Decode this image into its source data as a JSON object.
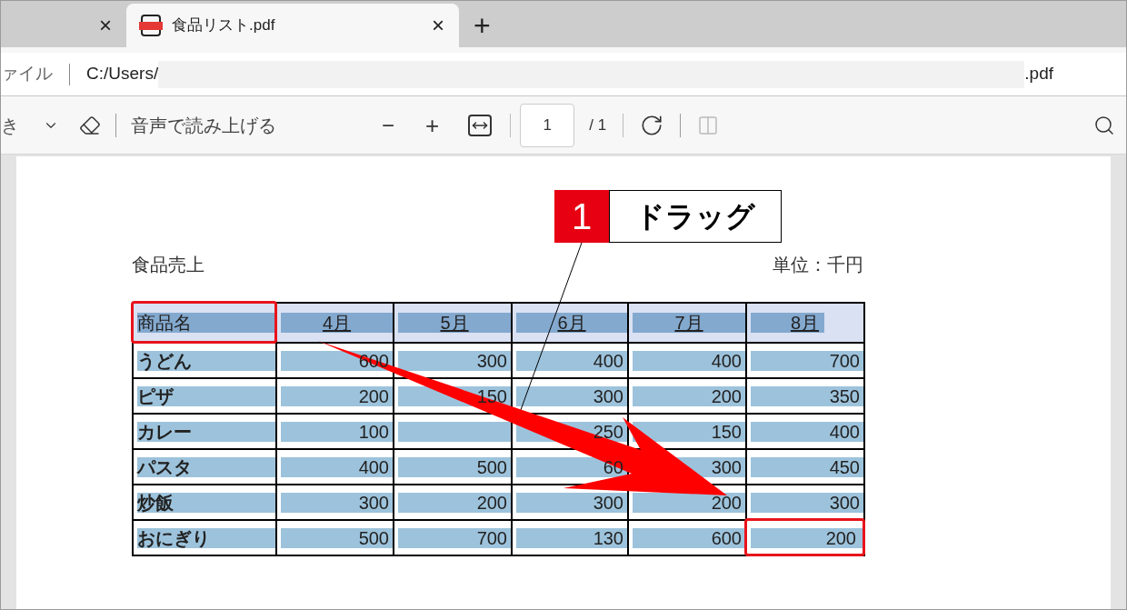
{
  "tabs": [
    {
      "selected": false,
      "close": "×"
    },
    {
      "selected": true,
      "title": "食品リスト.pdf",
      "close": "×"
    }
  ],
  "new_tab": "+",
  "address_bar": {
    "label": "ァイル",
    "path_start": "C:/Users/",
    "path_end": ".pdf"
  },
  "toolbar": {
    "cut_label": "き",
    "read_aloud": "音声で読み上げる",
    "zoom_out": "−",
    "zoom_in": "+",
    "page_field": "1",
    "page_total": "/ 1",
    "two_page_disabled": true
  },
  "document": {
    "title": "食品売上",
    "unit": "単位：千円",
    "text_selected": true,
    "table": {
      "columns": [
        {
          "text": "商品名",
          "outlined": true
        },
        {
          "text": "4月",
          "outlined": false
        },
        {
          "text": "5月",
          "outlined": false
        },
        {
          "text": "6月",
          "outlined": false
        },
        {
          "text": "7月",
          "outlined": false
        },
        {
          "text": "8月",
          "outlined": false
        }
      ],
      "rows": [
        {
          "cells": [
            {
              "text": "うどん",
              "outlined": false
            },
            {
              "text": "600",
              "outlined": false
            },
            {
              "text": "300",
              "outlined": false
            },
            {
              "text": "400",
              "outlined": false
            },
            {
              "text": "400",
              "outlined": false
            },
            {
              "text": "700",
              "outlined": false
            }
          ]
        },
        {
          "cells": [
            {
              "text": "ピザ",
              "outlined": false
            },
            {
              "text": "200",
              "outlined": false
            },
            {
              "text": "150",
              "outlined": false
            },
            {
              "text": "300",
              "outlined": false
            },
            {
              "text": "200",
              "outlined": false
            },
            {
              "text": "350",
              "outlined": false
            }
          ]
        },
        {
          "cells": [
            {
              "text": "カレー",
              "outlined": false
            },
            {
              "text": "100",
              "outlined": false
            },
            {
              "outlined": false
            },
            {
              "text": "250",
              "outlined": false
            },
            {
              "text": "150",
              "outlined": false
            },
            {
              "text": "400",
              "outlined": false
            }
          ]
        },
        {
          "cells": [
            {
              "text": "パスタ",
              "outlined": false
            },
            {
              "text": "400",
              "outlined": false
            },
            {
              "text": "500",
              "outlined": false
            },
            {
              "text": "60",
              "outlined": false
            },
            {
              "text": "300",
              "outlined": false
            },
            {
              "text": "450",
              "outlined": false
            }
          ]
        },
        {
          "cells": [
            {
              "text": "炒飯",
              "outlined": false
            },
            {
              "text": "300",
              "outlined": false
            },
            {
              "text": "200",
              "outlined": false
            },
            {
              "text": "300",
              "outlined": false
            },
            {
              "text": "200",
              "outlined": false
            },
            {
              "text": "300",
              "outlined": false
            }
          ]
        },
        {
          "cells": [
            {
              "text": "おにぎり",
              "outlined": false
            },
            {
              "text": "500",
              "outlined": false
            },
            {
              "text": "700",
              "outlined": false
            },
            {
              "text": "130",
              "outlined": false
            },
            {
              "text": "600",
              "outlined": false
            },
            {
              "text": "200",
              "outlined": true
            }
          ]
        }
      ]
    }
  },
  "callout": {
    "number": "1",
    "text": "ドラッグ"
  }
}
